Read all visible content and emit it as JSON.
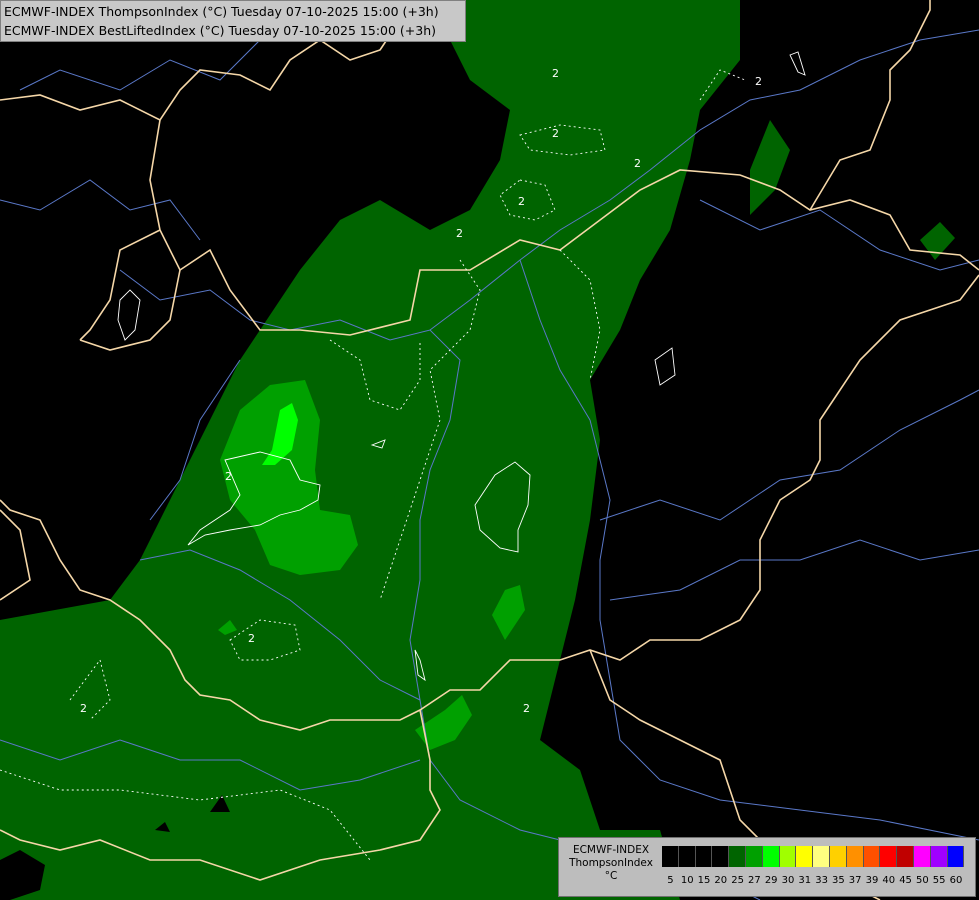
{
  "header": {
    "line1": "ECMWF-INDEX ThompsonIndex (°C) Tuesday 07-10-2025 15:00 (+3h)",
    "line2": "ECMWF-INDEX BestLiftedIndex (°C) Tuesday 07-10-2025 15:00 (+3h)"
  },
  "legend": {
    "line1": "ECMWF-INDEX",
    "line2": "ThompsonIndex",
    "line3": "°C",
    "ticks": [
      "5",
      "10",
      "15",
      "20",
      "25",
      "27",
      "29",
      "30",
      "31",
      "33",
      "35",
      "37",
      "39",
      "40",
      "45",
      "50",
      "55",
      "60"
    ],
    "colors": [
      "#000000",
      "#000000",
      "#000000",
      "#000000",
      "#006400",
      "#00a000",
      "#00ff00",
      "#a0ff00",
      "#ffff00",
      "#ffff80",
      "#ffd000",
      "#ff9000",
      "#ff5000",
      "#ff0000",
      "#c00000",
      "#ff00ff",
      "#a000ff",
      "#0000ff"
    ]
  },
  "map": {
    "contour_label": "2",
    "colors": {
      "background": "#000000",
      "green_dark": "#006400",
      "green_mid": "#00a000",
      "green_light": "#00ff00",
      "border": "#f5d7a8",
      "river": "#5a78c8",
      "contour": "#ffffff"
    }
  }
}
